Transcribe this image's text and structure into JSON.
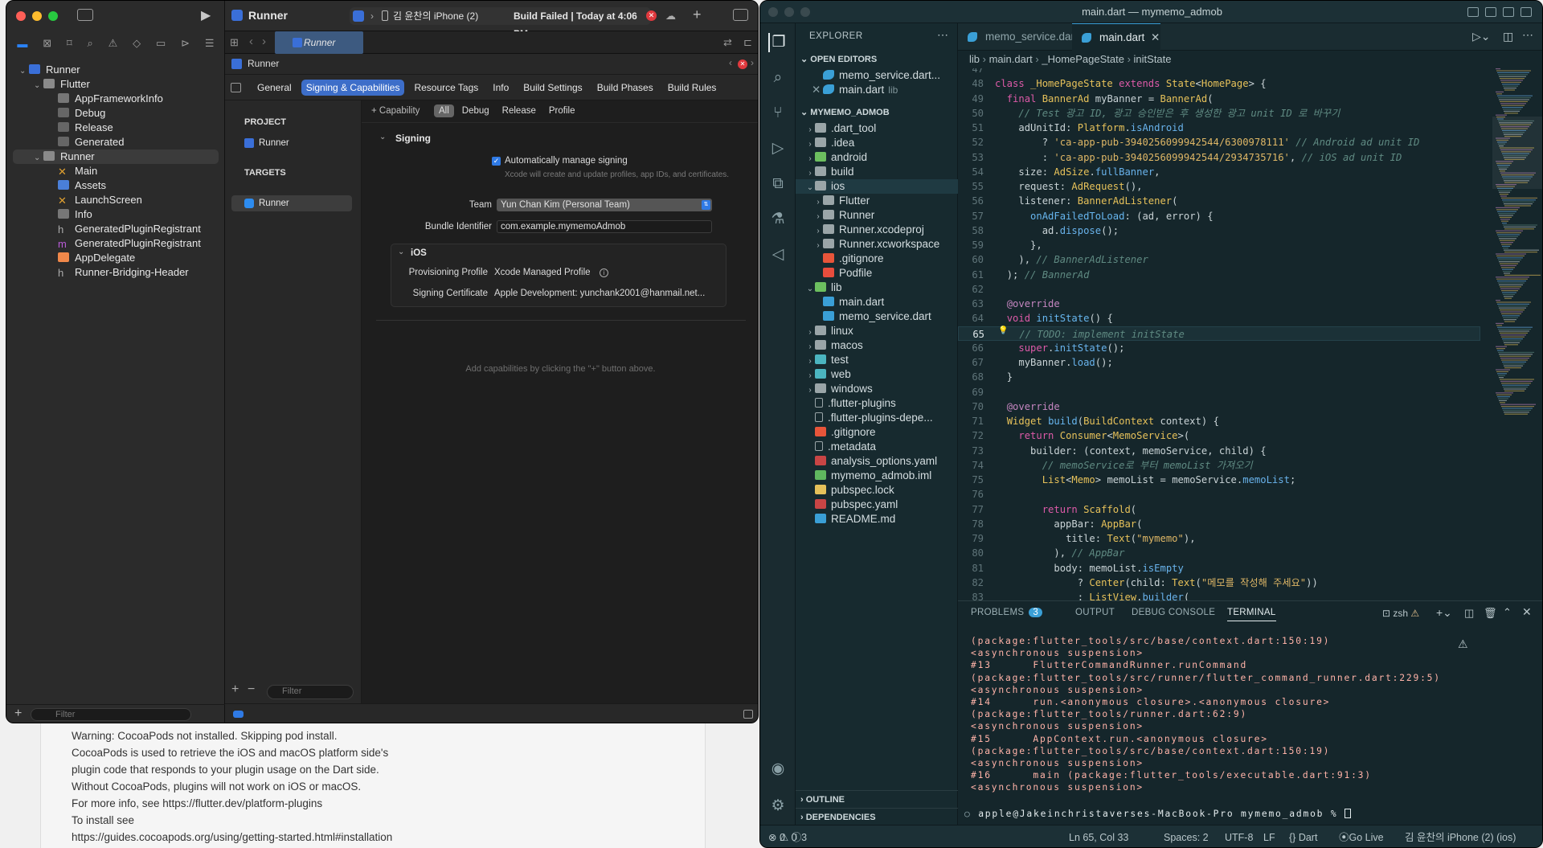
{
  "background_doc": {
    "lines": [
      "Warning: CocoaPods not installed. Skipping pod install.",
      "  CocoaPods is used to retrieve the iOS and macOS platform side's",
      "  plugin code that responds to your plugin usage on the Dart side.",
      "  Without CocoaPods, plugins will not work on iOS or macOS.",
      "  For more info, see https://flutter.dev/platform-plugins",
      "To install see",
      "https://guides.cocoapods.org/using/getting-started.html#installation"
    ]
  },
  "xcode": {
    "project_name": "Runner",
    "scheme": "Runner",
    "device": "김 윤찬의 iPhone (2)",
    "build_status": "Build Failed | Today at 4:06 PM",
    "tab_title": "Runner",
    "crumb": "Runner",
    "tree": [
      {
        "label": "Runner",
        "level": 0,
        "kind": "project",
        "chev": "⌄"
      },
      {
        "label": "Flutter",
        "level": 1,
        "kind": "folder",
        "chev": "⌄"
      },
      {
        "label": "AppFrameworkInfo",
        "level": 2,
        "kind": "plist",
        "chev": ""
      },
      {
        "label": "Debug",
        "level": 2,
        "kind": "config",
        "chev": ""
      },
      {
        "label": "Release",
        "level": 2,
        "kind": "config",
        "chev": ""
      },
      {
        "label": "Generated",
        "level": 2,
        "kind": "config",
        "chev": ""
      },
      {
        "label": "Runner",
        "level": 1,
        "kind": "folder",
        "chev": "⌄"
      },
      {
        "label": "Main",
        "level": 2,
        "kind": "storyboard",
        "chev": ""
      },
      {
        "label": "Assets",
        "level": 2,
        "kind": "assets",
        "chev": ""
      },
      {
        "label": "LaunchScreen",
        "level": 2,
        "kind": "storyboard",
        "chev": ""
      },
      {
        "label": "Info",
        "level": 2,
        "kind": "plist",
        "chev": ""
      },
      {
        "label": "GeneratedPluginRegistrant",
        "level": 2,
        "kind": "header",
        "chev": ""
      },
      {
        "label": "GeneratedPluginRegistrant",
        "level": 2,
        "kind": "objc",
        "chev": ""
      },
      {
        "label": "AppDelegate",
        "level": 2,
        "kind": "swift",
        "chev": ""
      },
      {
        "label": "Runner-Bridging-Header",
        "level": 2,
        "kind": "header",
        "chev": ""
      }
    ],
    "filter_placeholder": "Filter",
    "segments": [
      "General",
      "Signing & Capabilities",
      "Resource Tags",
      "Info",
      "Build Settings",
      "Build Phases",
      "Build Rules"
    ],
    "active_segment": "Signing & Capabilities",
    "project_header": "PROJECT",
    "project_item": "Runner",
    "targets_header": "TARGETS",
    "target_item": "Runner",
    "capability_btn": "+ Capability",
    "config_tabs": [
      "All",
      "Debug",
      "Release",
      "Profile"
    ],
    "signing": {
      "title": "Signing",
      "auto_label": "Automatically manage signing",
      "auto_note": "Xcode will create and update profiles, app IDs, and certificates.",
      "team_label": "Team",
      "team_value": "Yun Chan Kim (Personal Team)",
      "bundle_label": "Bundle Identifier",
      "bundle_value": "com.example.mymemoAdmob",
      "ios_title": "iOS",
      "prov_label": "Provisioning Profile",
      "prov_value": "Xcode Managed Profile",
      "cert_label": "Signing Certificate",
      "cert_value": "Apple Development: yunchank2001@hanmail.net..."
    },
    "empty_hint": "Add capabilities by clicking the \"+\" button above.",
    "bottom_filter": "Filter"
  },
  "vscode": {
    "title": "main.dart — mymemo_admob",
    "explorer_title": "EXPLORER",
    "open_editors": "OPEN EDITORS",
    "open_files": [
      {
        "name": "memo_service.dart...",
        "extra": ""
      },
      {
        "name": "main.dart",
        "extra": "lib"
      }
    ],
    "workspace": "MYMEMO_ADMOB",
    "files": [
      {
        "name": ".dart_tool",
        "indent": 0,
        "chev": "›",
        "kind": "folder"
      },
      {
        "name": ".idea",
        "indent": 0,
        "chev": "›",
        "kind": "folder"
      },
      {
        "name": "android",
        "indent": 0,
        "chev": "›",
        "kind": "folder-green"
      },
      {
        "name": "build",
        "indent": 0,
        "chev": "›",
        "kind": "folder"
      },
      {
        "name": "ios",
        "indent": 0,
        "chev": "⌄",
        "kind": "folder"
      },
      {
        "name": "Flutter",
        "indent": 1,
        "chev": "›",
        "kind": "folder"
      },
      {
        "name": "Runner",
        "indent": 1,
        "chev": "›",
        "kind": "folder"
      },
      {
        "name": "Runner.xcodeproj",
        "indent": 1,
        "chev": "›",
        "kind": "folder"
      },
      {
        "name": "Runner.xcworkspace",
        "indent": 1,
        "chev": "›",
        "kind": "folder"
      },
      {
        "name": ".gitignore",
        "indent": 1,
        "chev": "",
        "kind": "git"
      },
      {
        "name": "Podfile",
        "indent": 1,
        "chev": "",
        "kind": "ruby"
      },
      {
        "name": "lib",
        "indent": 0,
        "chev": "⌄",
        "kind": "folder-green"
      },
      {
        "name": "main.dart",
        "indent": 1,
        "chev": "",
        "kind": "dart"
      },
      {
        "name": "memo_service.dart",
        "indent": 1,
        "chev": "",
        "kind": "dart"
      },
      {
        "name": "linux",
        "indent": 0,
        "chev": "›",
        "kind": "folder"
      },
      {
        "name": "macos",
        "indent": 0,
        "chev": "›",
        "kind": "folder"
      },
      {
        "name": "test",
        "indent": 0,
        "chev": "›",
        "kind": "folder-teal"
      },
      {
        "name": "web",
        "indent": 0,
        "chev": "›",
        "kind": "folder-teal"
      },
      {
        "name": "windows",
        "indent": 0,
        "chev": "›",
        "kind": "folder"
      },
      {
        "name": ".flutter-plugins",
        "indent": 0,
        "chev": "",
        "kind": "file"
      },
      {
        "name": ".flutter-plugins-depe...",
        "indent": 0,
        "chev": "",
        "kind": "file"
      },
      {
        "name": ".gitignore",
        "indent": 0,
        "chev": "",
        "kind": "git"
      },
      {
        "name": ".metadata",
        "indent": 0,
        "chev": "",
        "kind": "file"
      },
      {
        "name": "analysis_options.yaml",
        "indent": 0,
        "chev": "",
        "kind": "yaml"
      },
      {
        "name": "mymemo_admob.iml",
        "indent": 0,
        "chev": "",
        "kind": "iml"
      },
      {
        "name": "pubspec.lock",
        "indent": 0,
        "chev": "",
        "kind": "lock"
      },
      {
        "name": "pubspec.yaml",
        "indent": 0,
        "chev": "",
        "kind": "yaml"
      },
      {
        "name": "README.md",
        "indent": 0,
        "chev": "",
        "kind": "info"
      }
    ],
    "outline": "OUTLINE",
    "dependencies": "DEPENDENCIES",
    "tabs": [
      {
        "name": "memo_service.dart",
        "active": false
      },
      {
        "name": "main.dart",
        "active": true
      }
    ],
    "breadcrumb": [
      "lib",
      "main.dart",
      "_HomePageState",
      "initState"
    ],
    "code_lines": [
      {
        "n": 47,
        "t": ""
      },
      {
        "n": 48,
        "t": "class _HomePageState extends State<HomePage> {"
      },
      {
        "n": 49,
        "t": "  final BannerAd myBanner = BannerAd("
      },
      {
        "n": 50,
        "t": "    // Test 광고 ID, 광고 승인받은 후 생성한 광고 unit ID 로 바꾸기"
      },
      {
        "n": 51,
        "t": "    adUnitId: Platform.isAndroid"
      },
      {
        "n": 52,
        "t": "        ? 'ca-app-pub-3940256099942544/6300978111' // Android ad unit ID"
      },
      {
        "n": 53,
        "t": "        : 'ca-app-pub-3940256099942544/2934735716', // iOS ad unit ID"
      },
      {
        "n": 54,
        "t": "    size: AdSize.fullBanner,"
      },
      {
        "n": 55,
        "t": "    request: AdRequest(),"
      },
      {
        "n": 56,
        "t": "    listener: BannerAdListener("
      },
      {
        "n": 57,
        "t": "      onAdFailedToLoad: (ad, error) {"
      },
      {
        "n": 58,
        "t": "        ad.dispose();"
      },
      {
        "n": 59,
        "t": "      },"
      },
      {
        "n": 60,
        "t": "    ), // BannerAdListener"
      },
      {
        "n": 61,
        "t": "  ); // BannerAd"
      },
      {
        "n": 62,
        "t": ""
      },
      {
        "n": 63,
        "t": "  @override"
      },
      {
        "n": 64,
        "t": "  void initState() {"
      },
      {
        "n": 65,
        "t": "    // TODO: implement initState"
      },
      {
        "n": 66,
        "t": "    super.initState();"
      },
      {
        "n": 67,
        "t": "    myBanner.load();"
      },
      {
        "n": 68,
        "t": "  }"
      },
      {
        "n": 69,
        "t": ""
      },
      {
        "n": 70,
        "t": "  @override"
      },
      {
        "n": 71,
        "t": "  Widget build(BuildContext context) {"
      },
      {
        "n": 72,
        "t": "    return Consumer<MemoService>("
      },
      {
        "n": 73,
        "t": "      builder: (context, memoService, child) {"
      },
      {
        "n": 74,
        "t": "        // memoService로 부터 memoList 가져오기"
      },
      {
        "n": 75,
        "t": "        List<Memo> memoList = memoService.memoList;"
      },
      {
        "n": 76,
        "t": ""
      },
      {
        "n": 77,
        "t": "        return Scaffold("
      },
      {
        "n": 78,
        "t": "          appBar: AppBar("
      },
      {
        "n": 79,
        "t": "            title: Text(\"mymemo\"),"
      },
      {
        "n": 80,
        "t": "          ), // AppBar"
      },
      {
        "n": 81,
        "t": "          body: memoList.isEmpty"
      },
      {
        "n": 82,
        "t": "              ? Center(child: Text(\"메모를 작성해 주세요\"))"
      },
      {
        "n": 83,
        "t": "              : ListView.builder("
      }
    ],
    "current_line": 65,
    "panel_tabs": [
      "PROBLEMS",
      "OUTPUT",
      "DEBUG CONSOLE",
      "TERMINAL"
    ],
    "problems_count": "3",
    "shell": "zsh",
    "terminal_lines": [
      "(package:flutter_tools/src/base/context.dart:150:19)",
      "<asynchronous suspension>",
      "#13      FlutterCommandRunner.runCommand",
      "(package:flutter_tools/src/runner/flutter_command_runner.dart:229:5)",
      "<asynchronous suspension>",
      "#14      run.<anonymous closure>.<anonymous closure>",
      "(package:flutter_tools/runner.dart:62:9)",
      "<asynchronous suspension>",
      "#15      AppContext.run.<anonymous closure>",
      "(package:flutter_tools/src/base/context.dart:150:19)",
      "<asynchronous suspension>",
      "#16      main (package:flutter_tools/executable.dart:91:3)",
      "<asynchronous suspension>"
    ],
    "prompt": "apple@Jakeinchristaverses-MacBook-Pro mymemo_admob % ",
    "status": {
      "errors": "0",
      "warnings": "0",
      "info": "3",
      "position": "Ln 65, Col 33",
      "spaces": "Spaces: 2",
      "encoding": "UTF-8",
      "eol": "LF",
      "language": "{} Dart",
      "golive": "Go Live",
      "device": "김 윤찬의 iPhone (2) (ios)"
    }
  }
}
